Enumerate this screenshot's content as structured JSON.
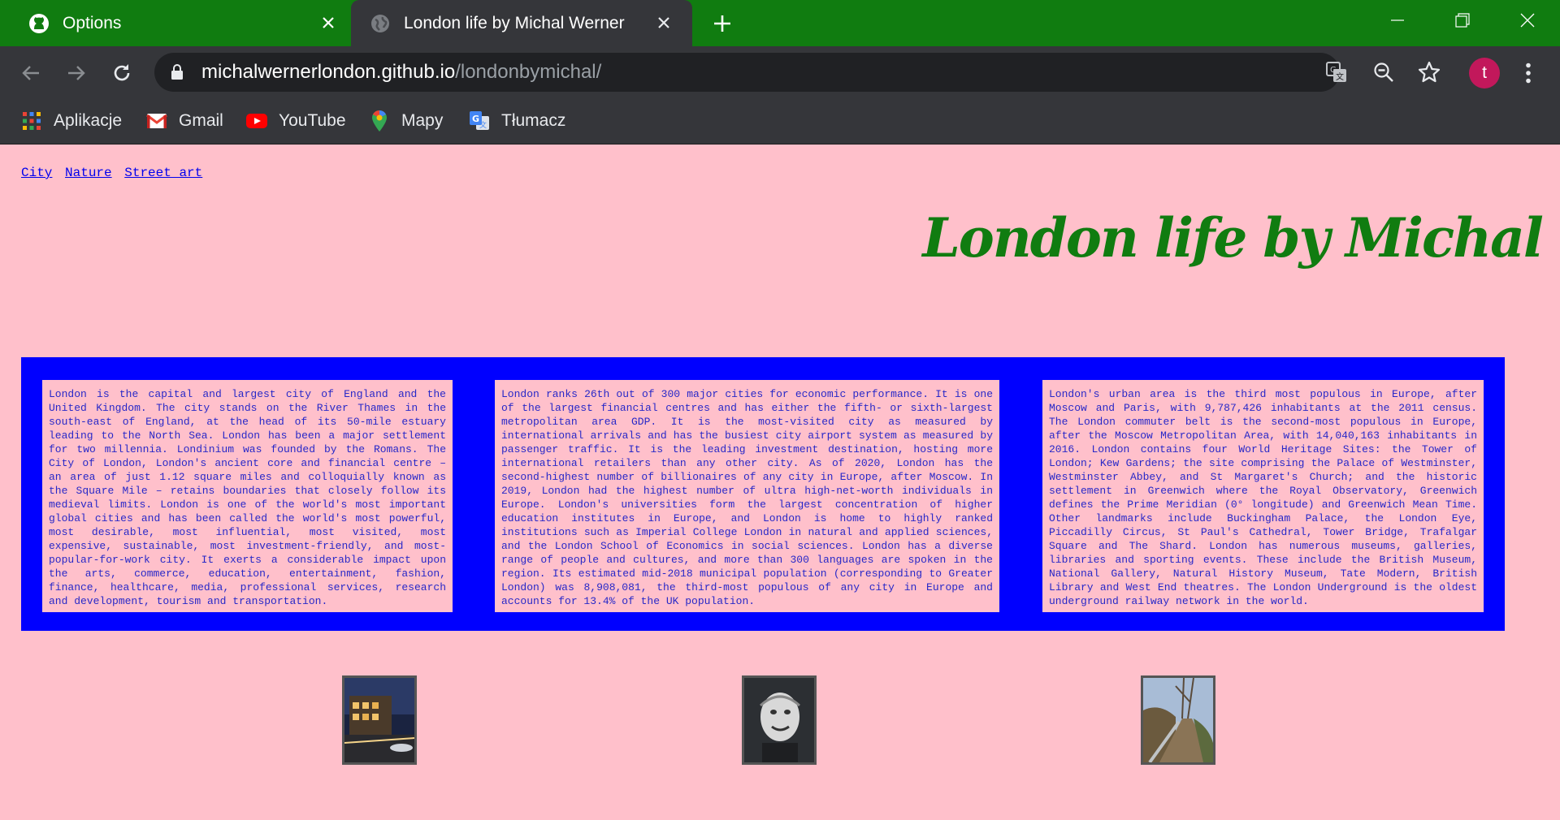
{
  "browser": {
    "tabs": [
      {
        "title": "Options",
        "icon": "github-icon"
      },
      {
        "title": "London life by Michal Werner",
        "icon": "globe-icon"
      }
    ],
    "url_host": "michalwernerlondon.github.io",
    "url_path": "/londonbymichal/",
    "profile_initial": "t",
    "bookmarks": [
      {
        "label": "Aplikacje",
        "icon": "apps-grid-icon"
      },
      {
        "label": "Gmail",
        "icon": "gmail-icon"
      },
      {
        "label": "YouTube",
        "icon": "youtube-icon"
      },
      {
        "label": "Mapy",
        "icon": "maps-pin-icon"
      },
      {
        "label": "Tłumacz",
        "icon": "translate-icon"
      }
    ],
    "colors": {
      "tab_strip": "#107c10",
      "toolbar": "#35363a",
      "omnibox": "#202124"
    }
  },
  "page": {
    "nav": [
      "City",
      "Nature",
      "Street art"
    ],
    "title": "London life by Michal",
    "columns": [
      "London is the capital and largest city of England and the United Kingdom. The city stands on the River Thames in the south-east of England, at the head of its 50-mile estuary leading to the North Sea. London has been a major settlement for two millennia. Londinium was founded by the Romans. The City of London, London's ancient core and financial centre – an area of just 1.12 square miles and colloquially known as the Square Mile – retains boundaries that closely follow its medieval limits. London is one of the world's most important global cities and has been called the world's most powerful, most desirable, most influential, most visited, most expensive, sustainable, most investment-friendly, and most-popular-for-work city. It exerts a considerable impact upon the arts, commerce, education, entertainment, fashion, finance, healthcare, media, professional services, research and development, tourism and transportation.",
      "London ranks 26th out of 300 major cities for economic performance. It is one of the largest financial centres and has either the fifth- or sixth-largest metropolitan area GDP. It is the most-visited city as measured by international arrivals and has the busiest city airport system as measured by passenger traffic. It is the leading investment destination, hosting more international retailers than any other city. As of 2020, London has the second-highest number of billionaires of any city in Europe, after Moscow. In 2019, London had the highest number of ultra high-net-worth individuals in Europe. London's universities form the largest concentration of higher education institutes in Europe, and London is home to highly ranked institutions such as Imperial College London in natural and applied sciences, and the London School of Economics in social sciences. London has a diverse range of people and cultures, and more than 300 languages are spoken in the region. Its estimated mid-2018 municipal population (corresponding to Greater London) was 8,908,081, the third-most populous of any city in Europe and accounts for 13.4% of the UK population.",
      "London's urban area is the third most populous in Europe, after Moscow and Paris, with 9,787,426 inhabitants at the 2011 census. The London commuter belt is the second-most populous in Europe, after the Moscow Metropolitan Area, with 14,040,163 inhabitants in 2016. London contains four World Heritage Sites: the Tower of London; Kew Gardens; the site comprising the Palace of Westminster, Westminster Abbey, and St Margaret's Church; and the historic settlement in Greenwich where the Royal Observatory, Greenwich defines the Prime Meridian (0° longitude) and Greenwich Mean Time. Other landmarks include Buckingham Palace, the London Eye, Piccadilly Circus, St Paul's Cathedral, Tower Bridge, Trafalgar Square and The Shard. London has numerous museums, galleries, libraries and sporting events. These include the British Museum, National Gallery, Natural History Museum, Tate Modern, British Library and West End theatres. The London Underground is the oldest underground railway network in the world."
    ],
    "thumbnails": [
      "city-night-street-photo",
      "street-art-portrait-photo",
      "nature-path-photo"
    ],
    "colors": {
      "background": "#ffc0cb",
      "box": "#0000ff",
      "title": "#107c10",
      "body_text": "#2828c8",
      "link": "#0000ee"
    }
  }
}
